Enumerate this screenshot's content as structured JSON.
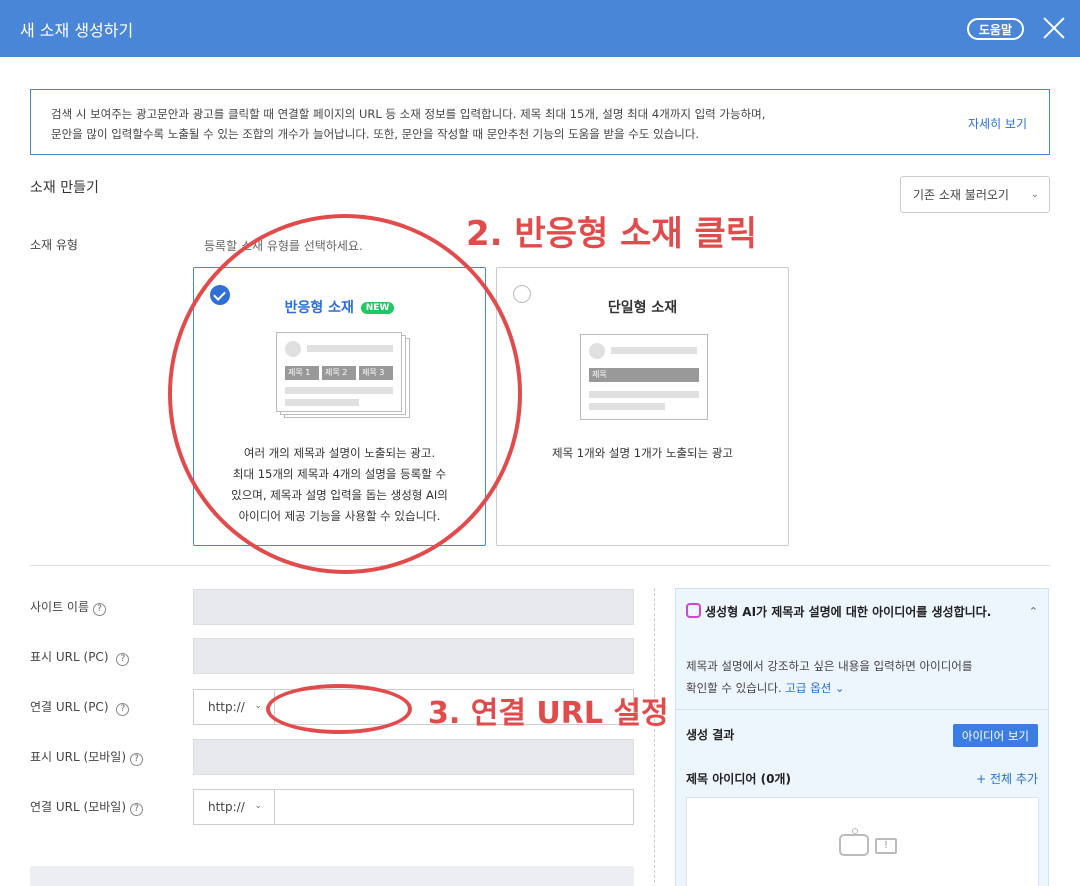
{
  "header": {
    "title": "새 소재 생성하기",
    "help_label": "도움말"
  },
  "notice": {
    "line1": "검색 시 보여주는 광고문안과 광고를 클릭할 때 연결할 페이지의 URL 등 소재 정보를 입력합니다. 제목 최대 15개, 설명 최대 4개까지 입력 가능하며,",
    "line2": "문안을 많이 입력할수록 노출될 수 있는 조합의 개수가 늘어납니다. 또한, 문안을 작성할 때 문안추천 기능의 도움을 받을 수도 있습니다.",
    "link": "자세히 보기"
  },
  "section": {
    "title": "소재 만들기",
    "load_button": "기존 소재 불러오기"
  },
  "ad_type": {
    "label": "소재 유형",
    "hint": "등록할 소재 유형를 선택하세요.",
    "responsive": {
      "title": "반응형 소재",
      "badge": "NEW",
      "chips": [
        "제목 1",
        "제목 2",
        "제목 3"
      ],
      "desc1": "여러 개의 제목과 설명이 노출되는 광고.",
      "desc2": "최대 15개의 제목과 4개의 설명을 등록할 수",
      "desc3": "있으며, 제목과 설명 입력을 돕는 생성형 AI의",
      "desc4": "아이디어 제공 기능을 사용할 수 있습니다."
    },
    "single": {
      "title": "단일형 소재",
      "chip": "제목",
      "desc": "제목 1개와 설명 1개가 노출되는 광고"
    }
  },
  "form": {
    "site_name": "사이트 이름",
    "display_url_pc": "표시 URL (PC)",
    "link_url_pc": "연결 URL (PC)",
    "display_url_mobile": "표시 URL (모바일)",
    "link_url_mobile": "연결 URL (모바일)",
    "protocol": "http://",
    "help_mark": "?"
  },
  "ai_panel": {
    "title": "생성형 AI가 제목과 설명에 대한 아이디어를 생성합니다.",
    "desc1": "제목과 설명에서 강조하고 싶은 내용을 입력하면 아이디어를",
    "desc2": "확인할 수 있습니다.",
    "advanced": "고급 옵션 ⌄",
    "result_label": "생성 결과",
    "idea_button": "아이디어 보기",
    "title_ideas": "제목 아이디어 (0개)",
    "add_all": "+ 전체 추가",
    "bubble": "!"
  },
  "annotations": {
    "step2": "2. 반응형 소재 클릭",
    "step3": "3. 연결 URL 설정"
  },
  "colors": {
    "header_bg": "#4a86d8",
    "accent": "#2a6fd6",
    "annotation": "#e24b4b",
    "new_badge": "#1ec862"
  }
}
